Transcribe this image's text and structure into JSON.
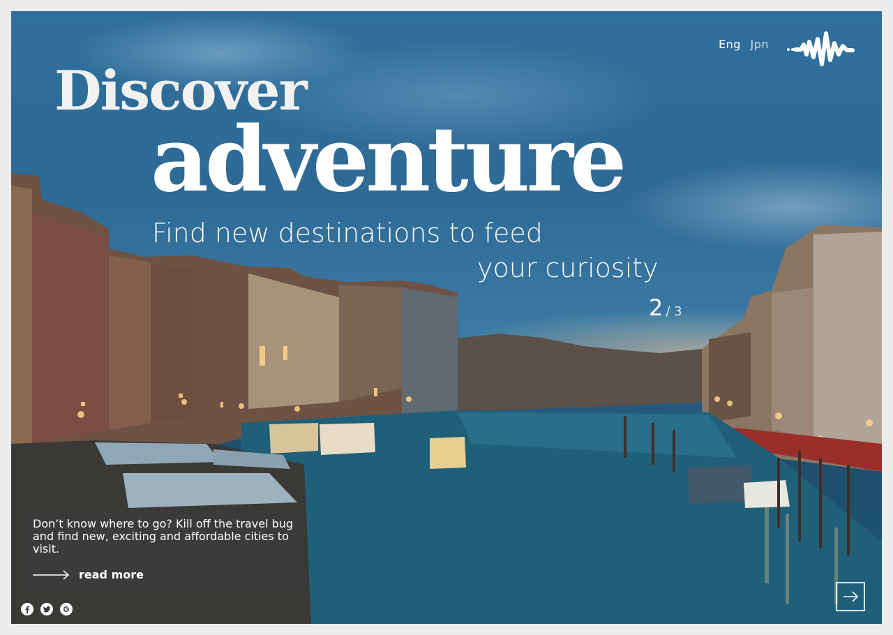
{
  "header": {
    "languages": [
      {
        "label": "Eng",
        "active": true
      },
      {
        "label": "Jpn",
        "active": false
      }
    ],
    "logo_icon": "soundwave-logo-icon"
  },
  "hero": {
    "headline_line1": "Discover",
    "headline_line2": "adventure",
    "subheadline_line1": "Find new destinations to feed",
    "subheadline_line2": "your curiosity"
  },
  "slider": {
    "current": "2",
    "total": "/ 3"
  },
  "info": {
    "text": "Don’t know where to go? Kill off the travel bug and find new, exciting and affordable cities to visit.",
    "read_more_label": "read more"
  },
  "socials": [
    {
      "icon": "facebook-icon"
    },
    {
      "icon": "twitter-icon"
    },
    {
      "icon": "google-icon"
    }
  ],
  "colors": {
    "sky": "#2f6f9c",
    "water": "#1f5f78",
    "text": "#ffffff",
    "overlay": "#3c3c3c"
  }
}
